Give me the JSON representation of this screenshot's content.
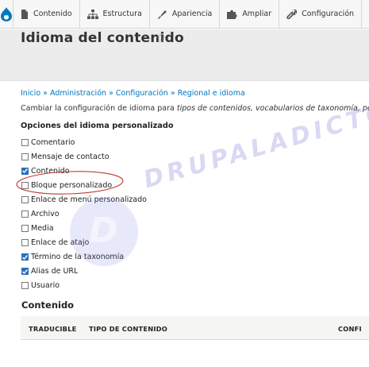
{
  "toolbar": {
    "logo_icon": "drupal-drop-icon",
    "items": [
      {
        "label": "Contenido",
        "icon": "document-icon"
      },
      {
        "label": "Estructura",
        "icon": "sitemap-icon"
      },
      {
        "label": "Apariencia",
        "icon": "paintbrush-icon"
      },
      {
        "label": "Ampliar",
        "icon": "puzzle-icon"
      },
      {
        "label": "Configuración",
        "icon": "wrench-icon"
      }
    ]
  },
  "header": {
    "title": "Idioma del contenido",
    "star_icon": "star-icon"
  },
  "breadcrumb": {
    "items": [
      "Inicio",
      "Administración",
      "Configuración",
      "Regional e idioma"
    ],
    "separator": "»"
  },
  "description": {
    "prefix": "Cambiar la configuración de idioma para ",
    "emphasis": "tipos de contenidos, vocabularios de taxonomía, per"
  },
  "options": {
    "title": "Opciones del idioma personalizado",
    "items": [
      {
        "label": "Comentario",
        "checked": false
      },
      {
        "label": "Mensaje de contacto",
        "checked": false
      },
      {
        "label": "Contenido",
        "checked": true
      },
      {
        "label": "Bloque personalizado",
        "checked": false
      },
      {
        "label": "Enlace de menú personalizado",
        "checked": false
      },
      {
        "label": "Archivo",
        "checked": false
      },
      {
        "label": "Media",
        "checked": false
      },
      {
        "label": "Enlace de atajo",
        "checked": false
      },
      {
        "label": "Término de la taxonomía",
        "checked": true
      },
      {
        "label": "Alias de URL",
        "checked": true
      },
      {
        "label": "Usuario",
        "checked": false
      }
    ]
  },
  "content_section": {
    "title": "Contenido",
    "columns": [
      "TRADUCIBLE",
      "TIPO DE CONTENIDO",
      "CONFI"
    ]
  },
  "watermark": {
    "text": "DRUPALADICTO",
    "letter": "D"
  },
  "colors": {
    "link": "#0074bd",
    "checkbox_checked": "#2a6fbd",
    "annotation_red": "#c0392b",
    "drupal_blue": "#0678be"
  }
}
